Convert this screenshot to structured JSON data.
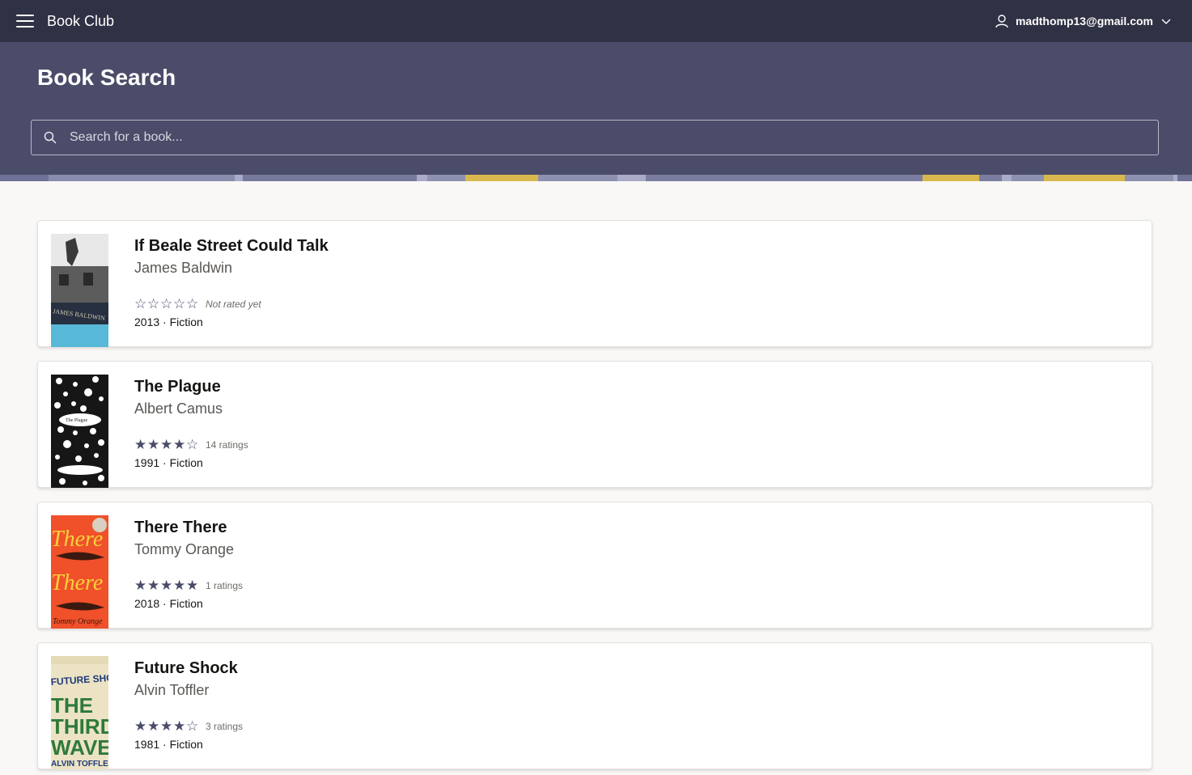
{
  "app": {
    "title": "Book Club",
    "user_email": "madthomp13@gmail.com"
  },
  "page": {
    "title": "Book Search"
  },
  "search": {
    "placeholder": "Search for a book..."
  },
  "colors": {
    "header": "#2f3144",
    "hero": "#4a4c69",
    "star": "#4a4c69",
    "background": "#f9f8f6"
  },
  "books": [
    {
      "title": "If Beale Street Could Talk",
      "author": "James Baldwin",
      "rating": 0,
      "rating_text": "Not rated yet",
      "year": "2013",
      "genre": "Fiction",
      "separator": " · ",
      "cover_text": "JAMES BALDWIN"
    },
    {
      "title": "The Plague",
      "author": "Albert Camus",
      "rating": 4,
      "rating_text": "14 ratings",
      "year": "1991",
      "genre": "Fiction",
      "separator": " · ",
      "cover_text": "The Plague"
    },
    {
      "title": "There There",
      "author": "Tommy Orange",
      "rating": 5,
      "rating_text": "1 ratings",
      "year": "2018",
      "genre": "Fiction",
      "separator": " · ",
      "cover_text": "There There"
    },
    {
      "title": "Future Shock",
      "author": "Alvin Toffler",
      "rating": 4,
      "rating_text": "3 ratings",
      "year": "1981",
      "genre": "Fiction",
      "separator": " · ",
      "cover_text": "FUTURE SHOCK"
    }
  ]
}
